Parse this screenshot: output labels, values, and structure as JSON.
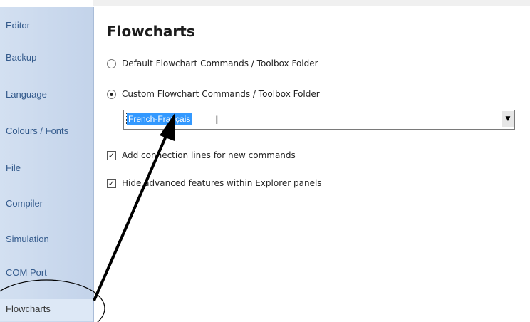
{
  "sidebar": {
    "items": [
      {
        "label": "Editor"
      },
      {
        "label": "Backup"
      },
      {
        "label": "Language"
      },
      {
        "label": "Colours / Fonts"
      },
      {
        "label": "File"
      },
      {
        "label": "Compiler"
      },
      {
        "label": "Simulation"
      },
      {
        "label": "COM Port"
      },
      {
        "label": "Flowcharts",
        "selected": true
      }
    ]
  },
  "main": {
    "title": "Flowcharts",
    "options": {
      "default_folder_label": "Default Flowchart Commands / Toolbox Folder",
      "default_folder_selected": false,
      "custom_folder_label": "Custom Flowchart Commands / Toolbox Folder",
      "custom_folder_selected": true
    },
    "folder_select": {
      "value": "French-Français"
    },
    "checkboxes": {
      "connection_lines_label": "Add connection lines for new commands",
      "connection_lines_checked": true,
      "hide_advanced_label": "Hide advanced features within Explorer panels",
      "hide_advanced_checked": true
    }
  },
  "colors": {
    "sidebar_bg": "#c7d7ee",
    "sidebar_text": "#335a8c",
    "selection_highlight": "#3399ff",
    "annotation": "#000000"
  }
}
